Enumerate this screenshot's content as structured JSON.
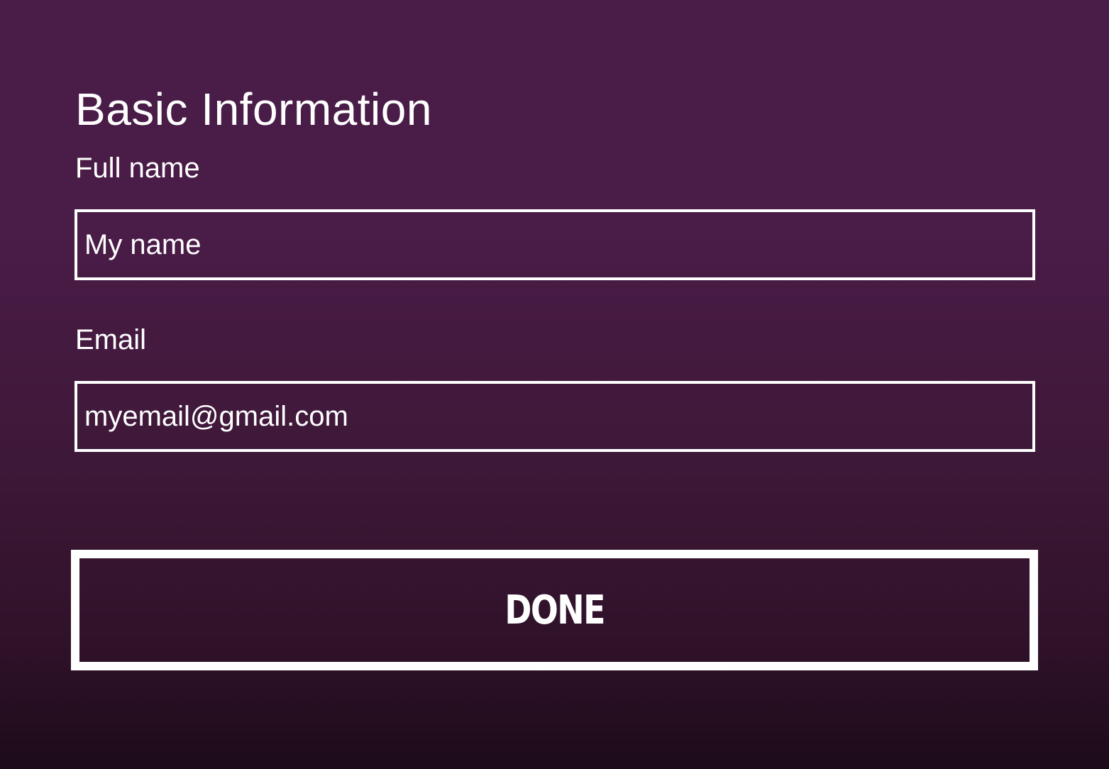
{
  "form": {
    "title": "Basic Information",
    "full_name": {
      "label": "Full name",
      "value": "My name"
    },
    "email": {
      "label": "Email",
      "value": "myemail@gmail.com"
    },
    "done_label": "DONE"
  },
  "colors": {
    "background_top": "#4a1c48",
    "background_bottom": "#1d0b19",
    "foreground": "#ffffff"
  }
}
